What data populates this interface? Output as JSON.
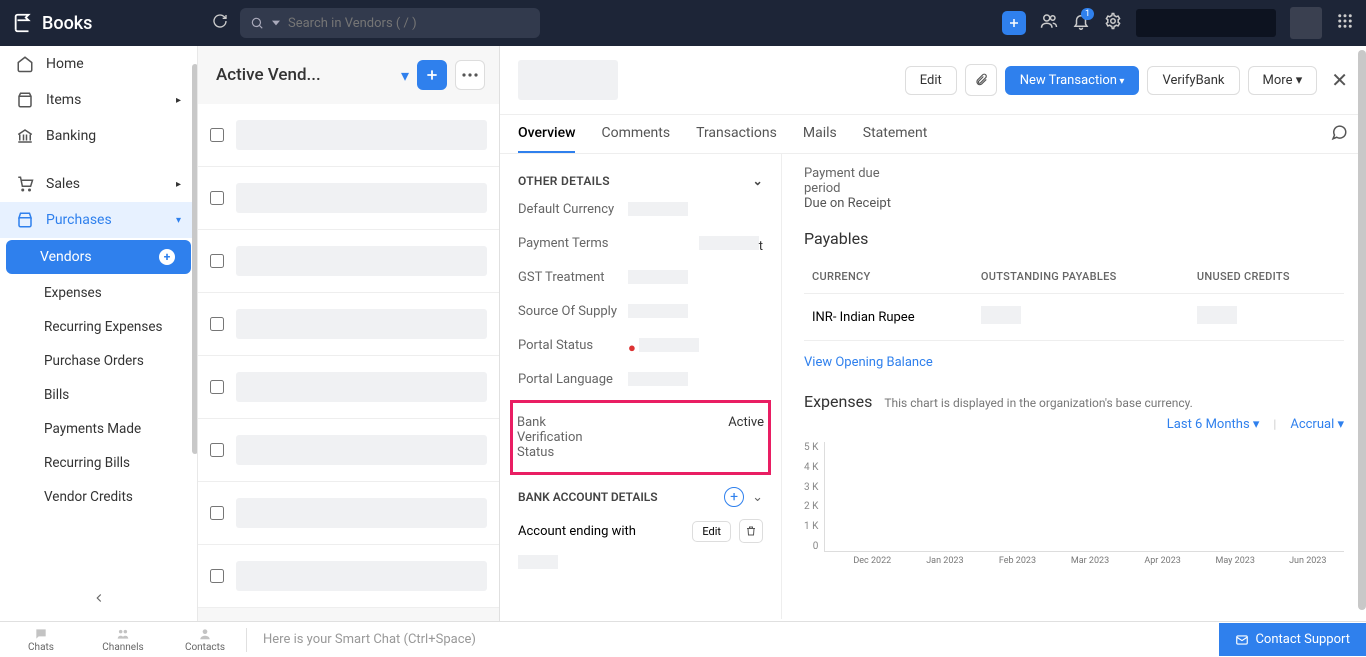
{
  "app": {
    "name": "Books"
  },
  "search": {
    "placeholder": "Search in Vendors ( / )"
  },
  "notif": {
    "count": "1"
  },
  "sidebar": {
    "home": "Home",
    "items": "Items",
    "banking": "Banking",
    "sales": "Sales",
    "purchases": "Purchases",
    "purchases_sub": {
      "vendors": "Vendors",
      "expenses": "Expenses",
      "recurring_expenses": "Recurring Expenses",
      "purchase_orders": "Purchase Orders",
      "bills": "Bills",
      "payments_made": "Payments Made",
      "recurring_bills": "Recurring Bills",
      "vendor_credits": "Vendor Credits"
    }
  },
  "list": {
    "title": "Active Vend..."
  },
  "actions": {
    "edit": "Edit",
    "new_transaction": "New Transaction",
    "verify_bank": "VerifyBank",
    "more": "More"
  },
  "tabs": {
    "overview": "Overview",
    "comments": "Comments",
    "transactions": "Transactions",
    "mails": "Mails",
    "statement": "Statement"
  },
  "details": {
    "section_other": "OTHER DETAILS",
    "default_currency": "Default Currency",
    "payment_terms": "Payment Terms",
    "payment_terms_val_suffix": "t",
    "gst_treatment": "GST Treatment",
    "source_of_supply": "Source Of Supply",
    "portal_status": "Portal Status",
    "portal_language": "Portal Language",
    "bank_verif_label": "Bank Verification Status",
    "bank_verif_value": "Active",
    "section_bank": "BANK ACCOUNT DETAILS",
    "account_ending": "Account ending with",
    "edit_small": "Edit"
  },
  "right": {
    "payment_due_label": "Payment due period",
    "payment_due_value": "Due on Receipt",
    "payables_title": "Payables",
    "col_currency": "CURRENCY",
    "col_outstanding": "OUTSTANDING PAYABLES",
    "col_unused": "UNUSED CREDITS",
    "row_currency": "INR- Indian Rupee",
    "view_opening": "View Opening Balance",
    "expenses_title": "Expenses",
    "expenses_note": "This chart is displayed in the organization's base currency.",
    "period": "Last 6 Months",
    "basis": "Accrual"
  },
  "chart_data": {
    "type": "bar",
    "categories": [
      "Dec 2022",
      "Jan 2023",
      "Feb 2023",
      "Mar 2023",
      "Apr 2023",
      "May 2023",
      "Jun 2023"
    ],
    "values": [
      0,
      0,
      0,
      0,
      0,
      0,
      0
    ],
    "y_ticks": [
      "5 K",
      "4 K",
      "3 K",
      "2 K",
      "1 K",
      "0"
    ],
    "ylim": [
      0,
      5000
    ],
    "xlabel": "",
    "ylabel": ""
  },
  "bottom": {
    "chats": "Chats",
    "channels": "Channels",
    "contacts": "Contacts",
    "smart_chat": "Here is your Smart Chat (Ctrl+Space)",
    "contact_support": "Contact Support"
  }
}
